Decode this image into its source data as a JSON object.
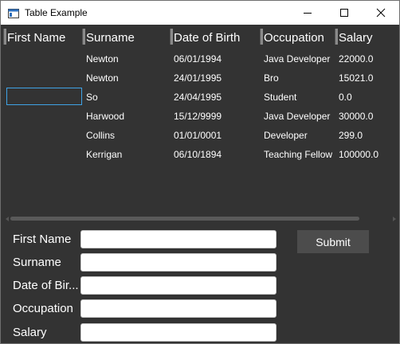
{
  "window": {
    "title": "Table Example",
    "app_icon": "window-app-icon"
  },
  "titlebar": {
    "minimize_icon": "minimize-icon",
    "maximize_icon": "maximize-icon",
    "close_icon": "close-icon"
  },
  "table": {
    "columns": [
      "First Name",
      "Surname",
      "Date of Birth",
      "Occupation",
      "Salary"
    ],
    "rows": [
      {
        "first_name": "",
        "surname": "Newton",
        "dob": "06/01/1994",
        "occupation": "Java Developer",
        "salary": "22000.0"
      },
      {
        "first_name": "",
        "surname": "Newton",
        "dob": "24/01/1995",
        "occupation": "Bro",
        "salary": "15021.0"
      },
      {
        "first_name": "",
        "surname": "So",
        "dob": "24/04/1995",
        "occupation": "Student",
        "salary": "0.0"
      },
      {
        "first_name": "",
        "surname": "Harwood",
        "dob": "15/12/9999",
        "occupation": "Java Developer",
        "salary": "30000.0"
      },
      {
        "first_name": "",
        "surname": "Collins",
        "dob": "01/01/0001",
        "occupation": "Developer",
        "salary": "299.0"
      },
      {
        "first_name": "",
        "surname": "Kerrigan",
        "dob": "06/10/1894",
        "occupation": "Teaching Fellow",
        "salary": "100000.0"
      }
    ]
  },
  "form": {
    "labels": {
      "first_name": "First Name",
      "surname": "Surname",
      "dob": "Date of Bir...",
      "occupation": "Occupation",
      "salary": "Salary"
    },
    "values": {
      "first_name": "",
      "surname": "",
      "dob": "",
      "occupation": "",
      "salary": ""
    },
    "submit_label": "Submit"
  },
  "colors": {
    "background": "#333333",
    "text": "#ffffff",
    "focus": "#3fa3e6",
    "button": "#4c4c4c"
  }
}
